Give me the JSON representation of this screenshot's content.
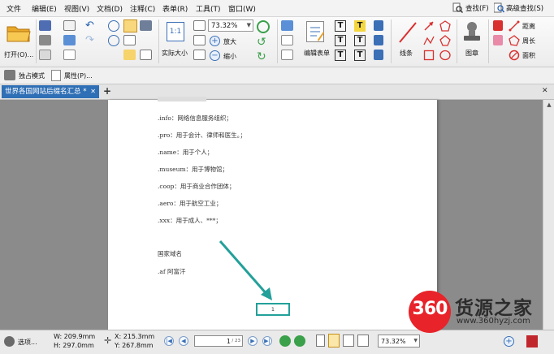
{
  "menubar": {
    "items": [
      "文件",
      "编辑(E)",
      "视图(V)",
      "文档(D)",
      "注释(C)",
      "表单(R)",
      "工具(T)",
      "窗口(W)"
    ],
    "find_label": "查找(F)",
    "advanced_find_label": "高级查找(S)"
  },
  "ribbon": {
    "open_label": "打开(O)...",
    "zoom_value": "73.32%",
    "zoom_in_label": "放大",
    "zoom_out_label": "缩小",
    "actual_size_label": "实际大小",
    "edit_form_label": "编辑表单",
    "line_label": "线条",
    "stamp_label": "图章",
    "distance_label": "距离",
    "perimeter_label": "周长",
    "area_label": "面积"
  },
  "toolbar2": {
    "standalone_mode_label": "独占模式",
    "properties_label": "属性(P)..."
  },
  "tab": {
    "title": "世界各国网站后缀名汇总 *"
  },
  "document": {
    "lines": [
      ".info：网络信息服务组织；",
      ".pro：用于会计、律师和医生。；",
      ".name：用于个人；",
      ".museum：用于博物馆；",
      ".coop：用于商业合作团体；",
      ".aero：用于航空工业；",
      ".xxx：用于成人、***；"
    ],
    "heading": "国家域名",
    "last_line": ".af 阿富汗",
    "page_number": "1"
  },
  "statusbar": {
    "options_label": "选项...",
    "width": "W: 209.9mm",
    "height": "H: 297.0mm",
    "x": "X: 215.3mm",
    "y": "Y: 267.8mm",
    "page_input": "1",
    "page_total": "/ 23",
    "zoom": "73.32%"
  },
  "watermark": {
    "logo_text": "360",
    "brand": "货源之家",
    "url": "www.360hyzj.com"
  },
  "colors": {
    "tab_active": "#2f6fb5",
    "highlight_box": "#23a09a",
    "arrow": "#23a09a",
    "watermark_red": "#e8232a"
  }
}
